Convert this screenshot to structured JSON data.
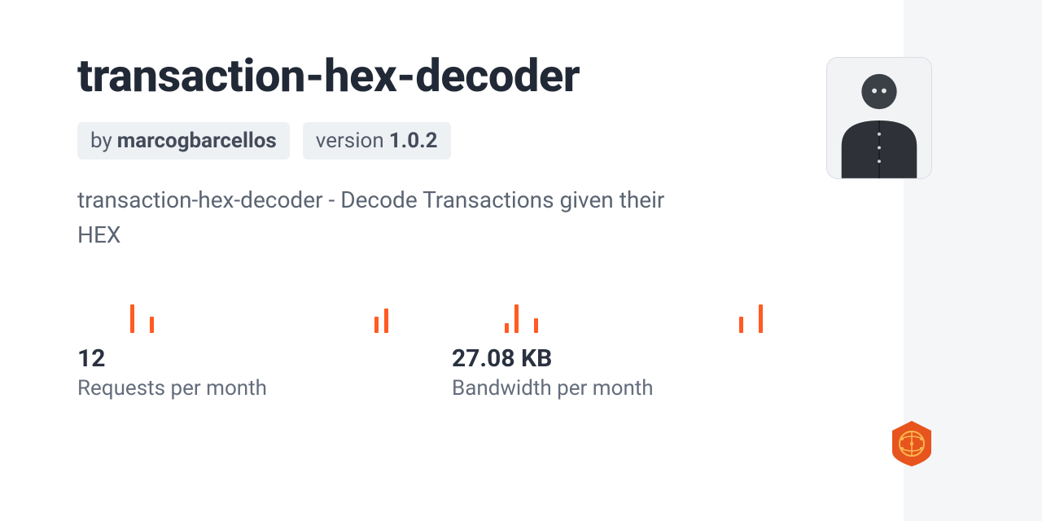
{
  "package": {
    "name": "transaction-hex-decoder",
    "author_prefix": "by",
    "author": "marcogbarcellos",
    "version_prefix": "version",
    "version": "1.0.2",
    "description": "transaction-hex-decoder - Decode Transactions given their HEX"
  },
  "stats": {
    "requests": {
      "value": "12",
      "label": "Requests per month"
    },
    "bandwidth": {
      "value": "27.08 KB",
      "label": "Bandwidth per month"
    }
  },
  "chart_data": [
    {
      "type": "bar",
      "title": "Requests sparkline",
      "categories": [
        "1",
        "2",
        "3",
        "4",
        "5",
        "6",
        "7",
        "8",
        "9",
        "10",
        "11",
        "12",
        "13",
        "14",
        "15",
        "16",
        "17",
        "18",
        "19",
        "20",
        "21",
        "22",
        "23",
        "24",
        "25",
        "26",
        "27"
      ],
      "values": [
        35,
        0,
        20,
        0,
        0,
        0,
        0,
        0,
        0,
        0,
        0,
        0,
        0,
        0,
        0,
        0,
        0,
        0,
        0,
        0,
        0,
        0,
        0,
        0,
        0,
        20,
        30
      ],
      "ylim": [
        0,
        50
      ]
    },
    {
      "type": "bar",
      "title": "Bandwidth sparkline",
      "categories": [
        "1",
        "2",
        "3",
        "4",
        "5",
        "6",
        "7",
        "8",
        "9",
        "10",
        "11",
        "12",
        "13",
        "14",
        "15",
        "16",
        "17",
        "18",
        "19",
        "20",
        "21",
        "22",
        "23",
        "24",
        "25",
        "26",
        "27"
      ],
      "values": [
        12,
        35,
        0,
        18,
        0,
        0,
        0,
        0,
        0,
        0,
        0,
        0,
        0,
        0,
        0,
        0,
        0,
        0,
        0,
        0,
        0,
        0,
        0,
        0,
        20,
        0,
        35
      ],
      "ylim": [
        0,
        50
      ]
    }
  ],
  "colors": {
    "accent": "#ff5b22",
    "badge": "#e8541e",
    "text_dark": "#212936",
    "text_muted": "#5b6472",
    "chip_bg": "#eef1f4"
  }
}
